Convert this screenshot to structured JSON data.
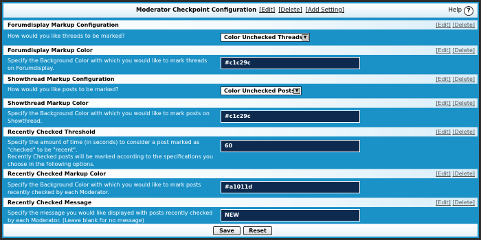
{
  "title_bar": {
    "title": "Moderator Checkpoint Configuration",
    "edit_link": "[Edit]",
    "delete_link": "[Delete]",
    "add_setting_link": "[Add Setting]",
    "help_label": "Help",
    "help_icon": "?"
  },
  "sections": [
    {
      "header": "Forumdisplay Markup Configuration",
      "edit": "[Edit]",
      "delete": "[Delete]",
      "label": "How would you like threads to be marked?",
      "control": "select",
      "value": "Color Unchecked Threads"
    },
    {
      "header": "Forumdisplay Markup Color",
      "edit": "[Edit]",
      "delete": "[Delete]",
      "label": "Specify the Background Color with which you would like to mark threads on Forumdisplay.",
      "control": "input",
      "value": "#c1c29c"
    },
    {
      "header": "Showthread Markup Configuration",
      "edit": "[Edit]",
      "delete": "[Delete]",
      "label": "How would you like posts to be marked?",
      "control": "select",
      "value": "Color Unchecked Posts"
    },
    {
      "header": "Showthread Markup Color",
      "edit": "[Edit]",
      "delete": "[Delete]",
      "label": "Specify the Background Color with which you would like to mark posts on Showthread.",
      "control": "input",
      "value": "#c1c29c"
    },
    {
      "header": "Recently Checked Threshold",
      "edit": "[Edit]",
      "delete": "[Delete]",
      "label": "Specify the amount of time (in seconds) to consider a post marked as \"checked\" to be \"recent\".",
      "label2": "Recently Checked posts will be marked according to the specifications you choose in the following options.",
      "control": "input",
      "value": "60"
    },
    {
      "header": "Recently Checked Markup Color",
      "edit": "[Edit]",
      "delete": "[Delete]",
      "label": "Specify the Background Color with which you would like to mark posts recently checked by each Moderator.",
      "control": "input",
      "value": "#a1011d"
    },
    {
      "header": "Recently Checked Message",
      "edit": "[Edit]",
      "delete": "[Delete]",
      "label": "Specify the message you would like displayed with posts recently checked by each Moderator. (Leave blank for no message)",
      "control": "input",
      "value": "NEW"
    }
  ],
  "footer": {
    "save_label": "Save",
    "reset_label": "Reset"
  },
  "colors": {
    "panel_blue": "#1a92c8",
    "input_navy": "#0e2b4f",
    "frame": "#2e2e2e"
  }
}
